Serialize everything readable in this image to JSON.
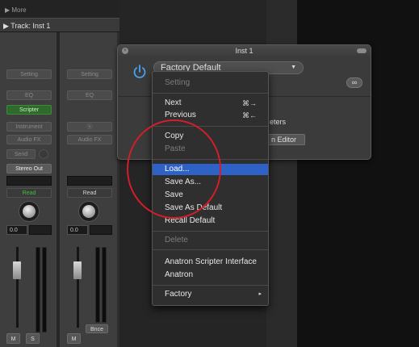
{
  "mixer": {
    "more_label": "▶ More",
    "track_label": "▶ Track:  Inst 1",
    "strip1": {
      "setting": "Setting",
      "eq": "EQ",
      "scripter": "Scripter",
      "instrument": "Instrument",
      "audio_fx": "Audio FX",
      "send": "Send",
      "stereo_out": "Stereo Out",
      "read": "Read",
      "value": "0.0",
      "mute": "M",
      "solo": "S"
    },
    "strip2": {
      "setting": "Setting",
      "eq": "EQ",
      "link_symbol": "ⓞ",
      "audio_fx": "Audio FX",
      "read": "Read",
      "value": "0.0",
      "mute": "M",
      "bounce": "Bnce"
    }
  },
  "plugin": {
    "title": "Inst 1",
    "close_symbol": "×",
    "preset": "Factory Default",
    "preset_arrow": "▼",
    "link_symbol": "∞",
    "params_text": "eters",
    "editor_button": "n Editor"
  },
  "menu": {
    "setting": "Setting",
    "next": "Next",
    "next_shortcut": "⌘→",
    "previous": "Previous",
    "previous_shortcut": "⌘←",
    "copy": "Copy",
    "paste": "Paste",
    "load": "Load...",
    "save_as": "Save As...",
    "save": "Save",
    "save_as_default": "Save As Default",
    "recall_default": "Recall Default",
    "delete": "Delete",
    "anatron_interface": "Anatron Scripter Interface",
    "anatron": "Anatron",
    "factory": "Factory",
    "factory_arrow": "▸"
  },
  "colors": {
    "highlight": "#2f62c6",
    "annotation": "#d11f2a",
    "power": "#4aa3f0",
    "green_slot": "#2f6a2c"
  }
}
